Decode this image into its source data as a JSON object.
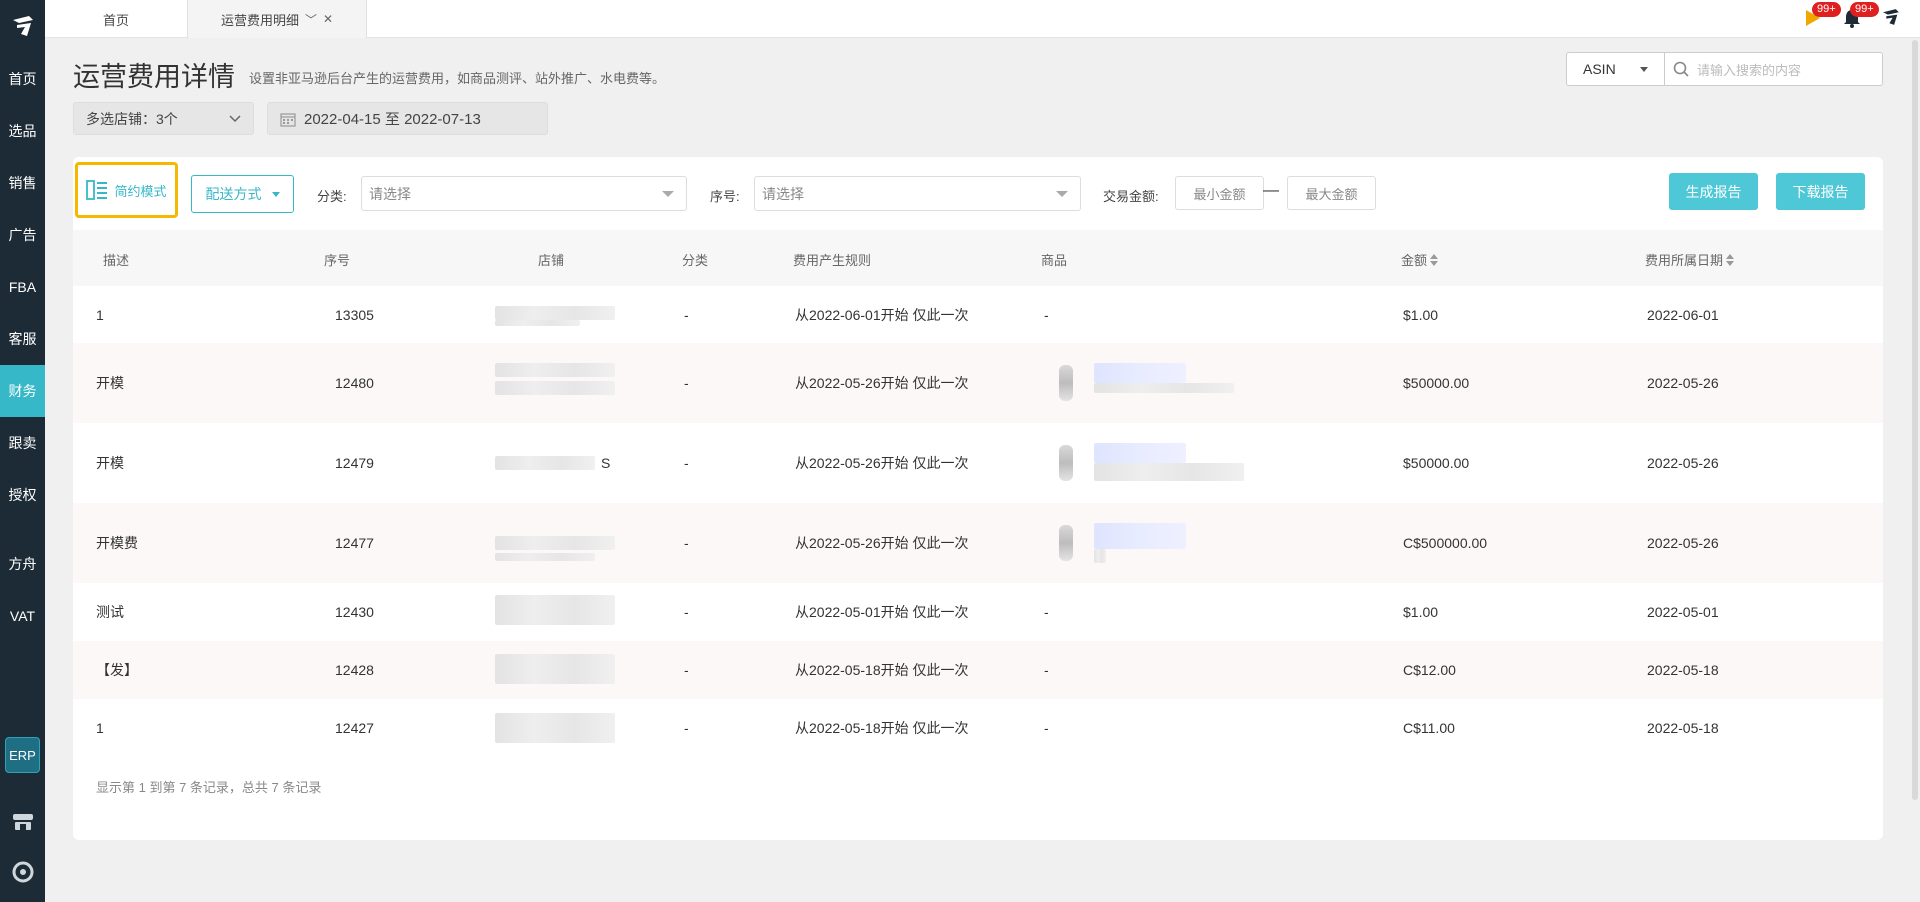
{
  "sidebar": {
    "items": [
      {
        "label": "首页"
      },
      {
        "label": "选品"
      },
      {
        "label": "销售"
      },
      {
        "label": "广告"
      },
      {
        "label": "FBA"
      },
      {
        "label": "客服"
      },
      {
        "label": "财务",
        "active": true
      },
      {
        "label": "跟卖"
      },
      {
        "label": "授权"
      },
      {
        "label": "方舟"
      },
      {
        "label": "VAT"
      }
    ],
    "erp_label": "ERP"
  },
  "tabs": {
    "home": "首页",
    "current": "运营费用明细"
  },
  "notifications": {
    "flag_badge": "99+",
    "bell_badge": "99+"
  },
  "header": {
    "title": "运营费用详情",
    "subtitle": "设置非亚马逊后台产生的运营费用，如商品测评、站外推广、水电费等。"
  },
  "search": {
    "field": "ASIN",
    "placeholder": "请输入搜索的内容"
  },
  "filters": {
    "store": "多选店铺：3个",
    "date_range": "2022-04-15 至 2022-07-13"
  },
  "toolbar": {
    "mode_label": "简约模式",
    "delivery_label": "配送方式",
    "category_label": "分类:",
    "category_placeholder": "请选择",
    "serial_label": "序号:",
    "serial_placeholder": "请选择",
    "amount_label": "交易金额:",
    "min_placeholder": "最小金额",
    "max_placeholder": "最大金额",
    "amount_dash": "—",
    "generate_label": "生成报告",
    "download_label": "下载报告"
  },
  "table": {
    "headers": {
      "desc": "描述",
      "serial": "序号",
      "store": "店铺",
      "category": "分类",
      "rule": "费用产生规则",
      "product": "商品",
      "amount": "金额",
      "date": "费用所属日期"
    },
    "rows": [
      {
        "desc": "1",
        "serial": "13305",
        "store_suffix": "",
        "category": "-",
        "rule": "从2022-06-01开始 仅此一次",
        "product": "-",
        "amount": "$1.00",
        "date": "2022-06-01"
      },
      {
        "desc": "开模",
        "serial": "12480",
        "store_suffix": "",
        "category": "-",
        "rule": "从2022-05-26开始 仅此一次",
        "product": "",
        "amount": "$50000.00",
        "date": "2022-05-26"
      },
      {
        "desc": "开模",
        "serial": "12479",
        "store_suffix": "S",
        "category": "-",
        "rule": "从2022-05-26开始 仅此一次",
        "product": "",
        "amount": "$50000.00",
        "date": "2022-05-26"
      },
      {
        "desc": "开模费",
        "serial": "12477",
        "store_suffix": "",
        "category": "-",
        "rule": "从2022-05-26开始 仅此一次",
        "product": "",
        "amount": "C$500000.00",
        "date": "2022-05-26"
      },
      {
        "desc": "测试",
        "serial": "12430",
        "store_suffix": "",
        "category": "-",
        "rule": "从2022-05-01开始 仅此一次",
        "product": "-",
        "amount": "$1.00",
        "date": "2022-05-01"
      },
      {
        "desc": "【发】",
        "serial": "12428",
        "store_suffix": "",
        "category": "-",
        "rule": "从2022-05-18开始 仅此一次",
        "product": "-",
        "amount": "C$12.00",
        "date": "2022-05-18"
      },
      {
        "desc": "1",
        "serial": "12427",
        "store_suffix": "",
        "category": "-",
        "rule": "从2022-05-18开始 仅此一次",
        "product": "-",
        "amount": "C$11.00",
        "date": "2022-05-18"
      }
    ],
    "footer": "显示第 1 到第 7 条记录，总共 7 条记录"
  }
}
